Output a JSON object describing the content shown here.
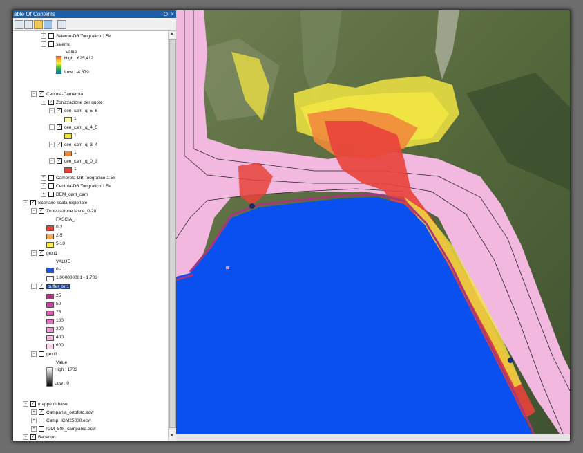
{
  "toc": {
    "title": "able Of Contents",
    "pin": "⭘",
    "close": "×"
  },
  "layers": {
    "salerno_db": "Salerno-DB Toografico 1:5k",
    "salerno": "salerno",
    "salerno_value": "Value",
    "salerno_high": "High : 625,412",
    "salerno_low": "Low : -4,379",
    "centola_camerota": "Centola-Camerota",
    "zonizzazione_quote": "Zonizzazione per quote",
    "cen_cam_q_5_6": "cen_cam_q_5_6",
    "cen_cam_q_4_5": "cen_cam_q_4_5",
    "cen_cam_q_3_4": "cen_cam_q_3_4",
    "cen_cam_q_0_3": "cen_cam_q_0_3",
    "class_one": "1",
    "camerota_db": "Camerota-DB Toografico 1:5k",
    "centola_db": "Centola-DB Toografico 1:5k",
    "dem_cent_cam": "DEM_cent_cam",
    "scenario": "Scenario scala regionale",
    "zonizzazione_fasce": "Zonizzazione fasce_0-20",
    "fascia_h": "FASCIA_H",
    "fascia": [
      "0-2",
      "2-5",
      "5-10"
    ],
    "gext1_a": "gext1",
    "gext_value": "VALUE",
    "gext_classes": [
      "0 - 1",
      "1,000000001 - 1.703"
    ],
    "buffer_tot1": "buffer_tot1",
    "buffer_classes": [
      "25",
      "50",
      "75",
      "100",
      "200",
      "400",
      "600"
    ],
    "gext1_b": "gext1",
    "gext1_b_value": "Value",
    "gext1_b_high": "High : 1703",
    "gext1_b_low": "Low : 0",
    "mappe_base": "mappe di base",
    "ortofoto": "Campania_ortofoto.ecw",
    "igm25": "Camp_IGM25000.ecw",
    "igm50": "IGM_50k_campania.ecw",
    "bacerion": "Bacerion"
  },
  "colors": {
    "fascia": [
      "#e8433a",
      "#f4a650",
      "#fde950"
    ],
    "gext": [
      "#1c55d6",
      "#ffffff"
    ],
    "buffer": [
      "#a8367c",
      "#c8449b",
      "#d257ad",
      "#dc72bd",
      "#e697cf",
      "#efbade",
      "#f6d3ea"
    ],
    "q": [
      "#fbf7a8",
      "#f0e442",
      "#f08a3c",
      "#e8433a"
    ],
    "sea": "#0a4ff0",
    "buffer_band": "#f2b8e0"
  }
}
